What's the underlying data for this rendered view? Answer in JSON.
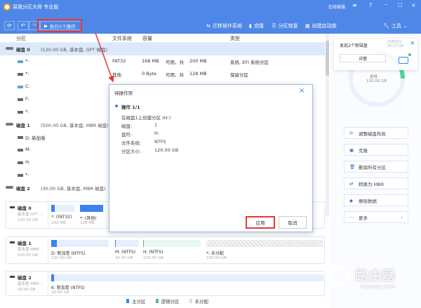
{
  "app": {
    "title": "易我分区大师 专业版",
    "online_service": "在线客服"
  },
  "toolbar": {
    "execute_label": "执行1个操作",
    "migrate_os": "迁移操作系统",
    "clone": "克隆",
    "partition_recovery": "分区恢复",
    "create_boot": "创建启动盘",
    "tools": "工具"
  },
  "table": {
    "headers": [
      "分区",
      "文件系统",
      "容量",
      "类型"
    ],
    "rows": [
      {
        "kind": "disk",
        "name": "磁盘 0",
        "info": "(120.00 GB, 基本盘, GPT 磁盘)"
      },
      {
        "kind": "part",
        "name": "*:",
        "fs": "FAT32",
        "free": "168 MB",
        "avail": "可用，共",
        "total": "200 MB",
        "type": "系统, EFI 系统分区"
      },
      {
        "kind": "part",
        "name": "*:",
        "fs": "其他",
        "free": "0 Byte",
        "avail": "可用，共",
        "total": "128 MB",
        "type": "保留分区"
      },
      {
        "kind": "part",
        "name": "C:"
      },
      {
        "kind": "part",
        "name": "F:"
      },
      {
        "kind": "part",
        "name": "*:"
      },
      {
        "kind": "disk",
        "name": "磁盘 1",
        "info": "(500.00 GB, 基本盘, MBR 磁盘)"
      },
      {
        "kind": "part",
        "name": "D: 新加卷"
      },
      {
        "kind": "part",
        "name": "M:"
      },
      {
        "kind": "part",
        "name": "H:"
      },
      {
        "kind": "part",
        "name": "*:"
      },
      {
        "kind": "disk",
        "name": "磁盘 2",
        "info": "(30.00 GB, 基本盘, MBR 磁盘)"
      }
    ]
  },
  "disk_map": [
    {
      "name": "磁盘 0",
      "type": "基本盘 GPT ...",
      "size": "120.00 GB",
      "parts": [
        {
          "label": "*: (FAT32)",
          "size": "200 MB",
          "fill": 0.16
        },
        {
          "label": "*: (其他)",
          "size": "128 MB",
          "fill": 1
        }
      ]
    },
    {
      "name": "磁盘 1",
      "type": "基本盘 MBR...",
      "size": "500.00 GB",
      "parts": [
        {
          "label": "D: 新加卷 (NTFS)",
          "size": "120.00 GB"
        },
        {
          "label": "M: (NTFS)",
          "size": "30.00 GB"
        },
        {
          "label": "H: (NTFS)",
          "size": "120.00 GB"
        },
        {
          "label": "*: 未分配",
          "size": "230.00 GB"
        }
      ]
    },
    {
      "name": "磁盘 2",
      "type": "基本盘 MBR...",
      "size": "30.00 GB",
      "parts": [
        {
          "label": "K: 新加卷 (NTFS)",
          "size": "30.00 GB"
        }
      ]
    }
  ],
  "legend": {
    "primary": "主分区",
    "logical": "逻辑分区",
    "unallocated": "未分配",
    "colors": {
      "primary": "#3b82f0",
      "logical": "#4cc27a",
      "unallocated": "#dddddd"
    }
  },
  "sidebar": {
    "popup_text": "发现2个新磁盘",
    "popup_button": "详情",
    "used_label": "已用空间",
    "used_value": "30.17 GB",
    "total_label": "总共",
    "total_value": "120.00 GB",
    "actions": [
      "调整磁盘布局",
      "克隆",
      "删除所有分区",
      "转换为 MBR",
      "擦除数据",
      "更多"
    ]
  },
  "dialog": {
    "title": "待操作项",
    "op_title": "操作 1/1",
    "desc": "在磁盘1上创建分区 (H:)",
    "fields": [
      {
        "k": "磁盘:",
        "v": "1"
      },
      {
        "k": "盘符:",
        "v": "H:"
      },
      {
        "k": "文件系统:",
        "v": "NTFS"
      },
      {
        "k": "分区大小:",
        "v": "120.00 GB"
      }
    ],
    "apply": "应用",
    "cancel": "取消"
  },
  "watermark": {
    "main": "路由器",
    "sub": "luyouqi.com"
  }
}
